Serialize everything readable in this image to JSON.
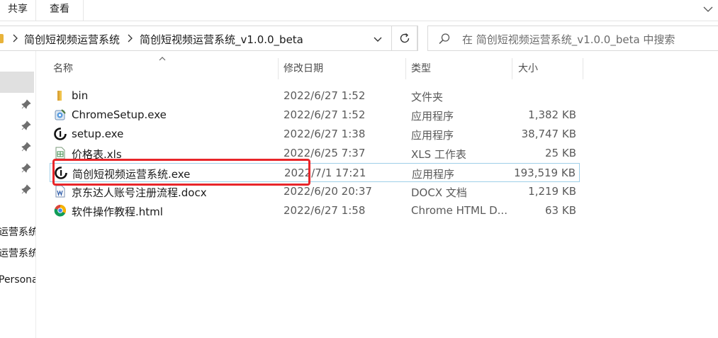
{
  "ribbon": {
    "tabs": [
      "共享",
      "查看"
    ]
  },
  "address": {
    "crumbs": [
      "简创短视频运营系统",
      "简创短视频运营系统_v1.0.0_beta"
    ]
  },
  "search": {
    "placeholder": "在 简创短视频运营系统_v1.0.0_beta 中搜索"
  },
  "nav": {
    "items": [
      "运营系统",
      "运营系统",
      "Persona"
    ]
  },
  "columns": {
    "name": "名称",
    "modified": "修改日期",
    "type": "类型",
    "size": "大小"
  },
  "files": [
    {
      "name": "bin",
      "modified": "2022/6/27 1:52",
      "type": "文件夹",
      "size": "",
      "icon": "folder-icon"
    },
    {
      "name": "ChromeSetup.exe",
      "modified": "2022/6/27 1:52",
      "type": "应用程序",
      "size": "1,382 KB",
      "icon": "installer-icon"
    },
    {
      "name": "setup.exe",
      "modified": "2022/6/27 1:38",
      "type": "应用程序",
      "size": "38,747 KB",
      "icon": "app-logo-icon"
    },
    {
      "name": "价格表.xls",
      "modified": "2022/6/25 7:37",
      "type": "XLS 工作表",
      "size": "25 KB",
      "icon": "spreadsheet-icon"
    },
    {
      "name": "简创短视频运营系统.exe",
      "modified": "2022/7/1 17:21",
      "type": "应用程序",
      "size": "193,519 KB",
      "icon": "app-logo-icon"
    },
    {
      "name": "京东达人账号注册流程.docx",
      "modified": "2022/6/20 20:37",
      "type": "DOCX 文档",
      "size": "1,219 KB",
      "icon": "word-doc-icon"
    },
    {
      "name": "软件操作教程.html",
      "modified": "2022/6/27 1:58",
      "type": "Chrome HTML D...",
      "size": "63 KB",
      "icon": "chrome-icon"
    }
  ],
  "colors": {
    "highlight": "#e8262a",
    "selection_border": "#9fcfe8",
    "folder": "#e8b33a"
  }
}
